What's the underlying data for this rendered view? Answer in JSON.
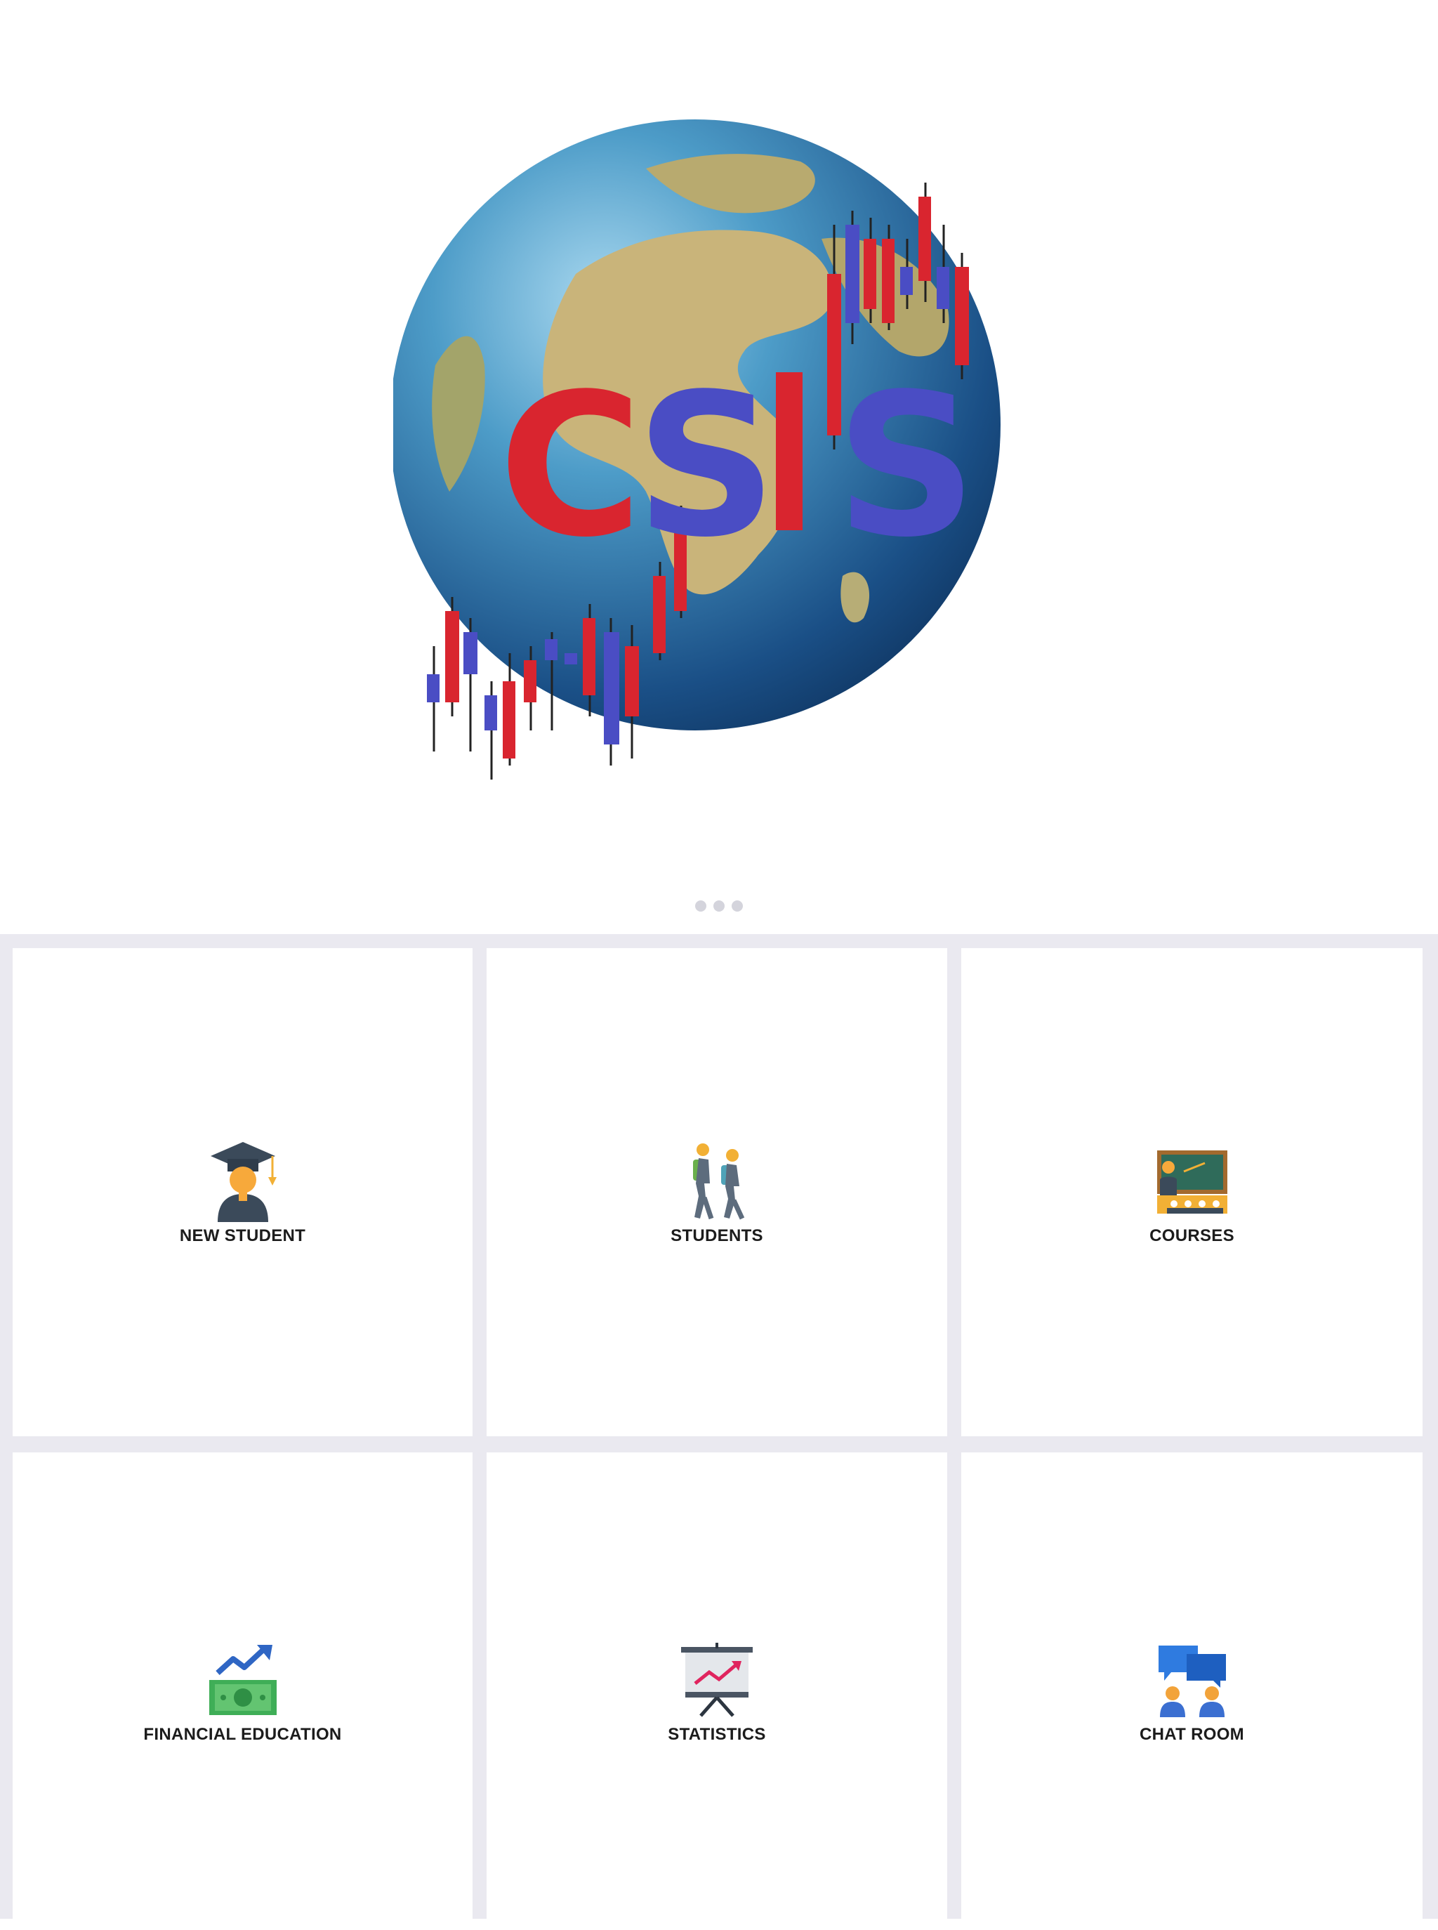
{
  "logo": {
    "text": "CSIS",
    "icon": "globe-candlestick-logo-icon",
    "colors": {
      "red": "#d9252f",
      "blue": "#4a4dc4",
      "ocean": "#1f5f99"
    }
  },
  "pager": {
    "pages": 3,
    "current": 1
  },
  "menu": {
    "tiles": [
      {
        "label": "NEW STUDENT",
        "icon": "graduate-student-icon"
      },
      {
        "label": "STUDENTS",
        "icon": "students-walking-icon"
      },
      {
        "label": "COURSES",
        "icon": "classroom-teacher-icon"
      },
      {
        "label": "FINANCIAL EDUCATION",
        "icon": "money-growth-icon"
      },
      {
        "label": "STATISTICS",
        "icon": "statistics-board-icon"
      },
      {
        "label": "CHAT ROOM",
        "icon": "chat-room-icon"
      }
    ]
  }
}
